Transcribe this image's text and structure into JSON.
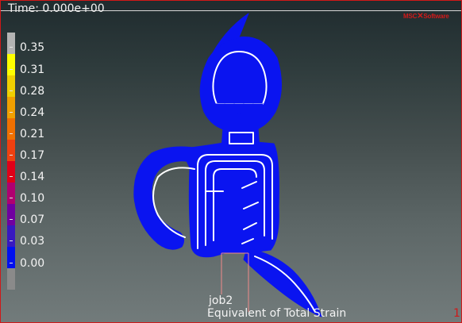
{
  "viewport": {
    "time_label": "Time: 0.000e+00",
    "logo_prefix": "MSC",
    "logo_mark": "✕",
    "logo_suffix": "Software",
    "job_label": "job2",
    "variable_label": "Equivalent of Total Strain",
    "frame_number": "1"
  },
  "legend": {
    "labels": [
      "0.35",
      "0.31",
      "0.28",
      "0.24",
      "0.21",
      "0.17",
      "0.14",
      "0.10",
      "0.07",
      "0.03",
      "0.00"
    ],
    "colors": [
      "#b4b4b4",
      "#ffff00",
      "#f0d000",
      "#f0a000",
      "#f07000",
      "#f04010",
      "#e00018",
      "#b00070",
      "#7000a0",
      "#3818c0",
      "#0010f0",
      "#8a8a8a"
    ]
  },
  "model": {
    "fill_color": "#0a14f0",
    "outline_color": "#ffffff",
    "highlight_color": "#f08a8a"
  }
}
